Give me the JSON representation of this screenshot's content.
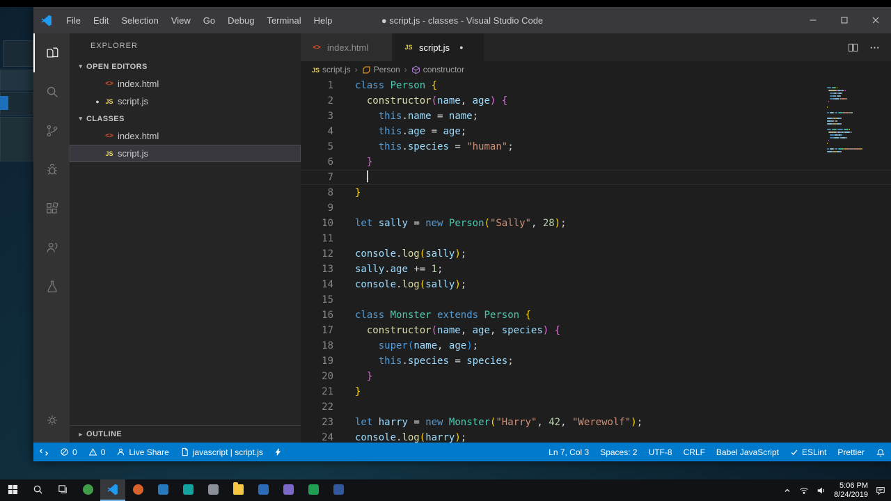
{
  "window": {
    "title": "● script.js - classes - Visual Studio Code",
    "menus": [
      "File",
      "Edit",
      "Selection",
      "View",
      "Go",
      "Debug",
      "Terminal",
      "Help"
    ]
  },
  "activity_bar": {
    "top": [
      {
        "name": "explorer",
        "icon": "explorer-icon",
        "active": true
      },
      {
        "name": "search",
        "icon": "search-icon"
      },
      {
        "name": "source-control",
        "icon": "source-control-icon"
      },
      {
        "name": "debug",
        "icon": "debug-icon"
      },
      {
        "name": "extensions",
        "icon": "extensions-icon"
      },
      {
        "name": "live-share",
        "icon": "live-share-icon"
      },
      {
        "name": "test",
        "icon": "test-icon"
      }
    ],
    "bottom": [
      {
        "name": "settings",
        "icon": "settings-icon"
      }
    ]
  },
  "explorer": {
    "title": "EXPLORER",
    "open_editors": {
      "label": "OPEN EDITORS",
      "items": [
        {
          "file": "index.html",
          "type": "html",
          "modified": false
        },
        {
          "file": "script.js",
          "type": "js",
          "modified": true
        }
      ]
    },
    "folder": {
      "label": "CLASSES",
      "items": [
        {
          "file": "index.html",
          "type": "html",
          "selected": false
        },
        {
          "file": "script.js",
          "type": "js",
          "selected": true
        }
      ]
    },
    "outline_label": "OUTLINE"
  },
  "tabs": [
    {
      "label": "index.html",
      "type": "html",
      "active": false,
      "modified": false
    },
    {
      "label": "script.js",
      "type": "js",
      "active": true,
      "modified": true
    }
  ],
  "breadcrumbs": [
    {
      "label": "script.js",
      "icon": "js-file-icon"
    },
    {
      "label": "Person",
      "icon": "symbol-class-icon"
    },
    {
      "label": "constructor",
      "icon": "symbol-method-icon"
    }
  ],
  "editor": {
    "cursor": {
      "line": 7,
      "col": 3
    },
    "lines": [
      [
        [
          "k",
          "class"
        ],
        [
          "p",
          " "
        ],
        [
          "c",
          "Person"
        ],
        [
          "p",
          " "
        ],
        [
          "1",
          "{"
        ]
      ],
      [
        [
          "p",
          "  "
        ],
        [
          "f",
          "constructor"
        ],
        [
          "2",
          "("
        ],
        [
          "v",
          "name"
        ],
        [
          "p",
          ", "
        ],
        [
          "v",
          "age"
        ],
        [
          "2",
          ")"
        ],
        [
          "p",
          " "
        ],
        [
          "2",
          "{"
        ]
      ],
      [
        [
          "p",
          "    "
        ],
        [
          "k",
          "this"
        ],
        [
          "p",
          "."
        ],
        [
          "v",
          "name"
        ],
        [
          "p",
          " = "
        ],
        [
          "v",
          "name"
        ],
        [
          "p",
          ";"
        ]
      ],
      [
        [
          "p",
          "    "
        ],
        [
          "k",
          "this"
        ],
        [
          "p",
          "."
        ],
        [
          "v",
          "age"
        ],
        [
          "p",
          " = "
        ],
        [
          "v",
          "age"
        ],
        [
          "p",
          ";"
        ]
      ],
      [
        [
          "p",
          "    "
        ],
        [
          "k",
          "this"
        ],
        [
          "p",
          "."
        ],
        [
          "v",
          "species"
        ],
        [
          "p",
          " = "
        ],
        [
          "s",
          "\"human\""
        ],
        [
          "p",
          ";"
        ]
      ],
      [
        [
          "p",
          "  "
        ],
        [
          "2",
          "}"
        ]
      ],
      [
        [
          "p",
          "  "
        ]
      ],
      [
        [
          "1",
          "}"
        ]
      ],
      [],
      [
        [
          "k",
          "let"
        ],
        [
          "p",
          " "
        ],
        [
          "v",
          "sally"
        ],
        [
          "p",
          " = "
        ],
        [
          "k",
          "new"
        ],
        [
          "p",
          " "
        ],
        [
          "c",
          "Person"
        ],
        [
          "1",
          "("
        ],
        [
          "s",
          "\"Sally\""
        ],
        [
          "p",
          ", "
        ],
        [
          "n",
          "28"
        ],
        [
          "1",
          ")"
        ],
        [
          "p",
          ";"
        ]
      ],
      [],
      [
        [
          "v",
          "console"
        ],
        [
          "p",
          "."
        ],
        [
          "f",
          "log"
        ],
        [
          "1",
          "("
        ],
        [
          "v",
          "sally"
        ],
        [
          "1",
          ")"
        ],
        [
          "p",
          ";"
        ]
      ],
      [
        [
          "v",
          "sally"
        ],
        [
          "p",
          "."
        ],
        [
          "v",
          "age"
        ],
        [
          "p",
          " += "
        ],
        [
          "n",
          "1"
        ],
        [
          "p",
          ";"
        ]
      ],
      [
        [
          "v",
          "console"
        ],
        [
          "p",
          "."
        ],
        [
          "f",
          "log"
        ],
        [
          "1",
          "("
        ],
        [
          "v",
          "sally"
        ],
        [
          "1",
          ")"
        ],
        [
          "p",
          ";"
        ]
      ],
      [],
      [
        [
          "k",
          "class"
        ],
        [
          "p",
          " "
        ],
        [
          "c",
          "Monster"
        ],
        [
          "p",
          " "
        ],
        [
          "k",
          "extends"
        ],
        [
          "p",
          " "
        ],
        [
          "c",
          "Person"
        ],
        [
          "p",
          " "
        ],
        [
          "1",
          "{"
        ]
      ],
      [
        [
          "p",
          "  "
        ],
        [
          "f",
          "constructor"
        ],
        [
          "2",
          "("
        ],
        [
          "v",
          "name"
        ],
        [
          "p",
          ", "
        ],
        [
          "v",
          "age"
        ],
        [
          "p",
          ", "
        ],
        [
          "v",
          "species"
        ],
        [
          "2",
          ")"
        ],
        [
          "p",
          " "
        ],
        [
          "2",
          "{"
        ]
      ],
      [
        [
          "p",
          "    "
        ],
        [
          "k",
          "super"
        ],
        [
          "3",
          "("
        ],
        [
          "v",
          "name"
        ],
        [
          "p",
          ", "
        ],
        [
          "v",
          "age"
        ],
        [
          "3",
          ")"
        ],
        [
          "p",
          ";"
        ]
      ],
      [
        [
          "p",
          "    "
        ],
        [
          "k",
          "this"
        ],
        [
          "p",
          "."
        ],
        [
          "v",
          "species"
        ],
        [
          "p",
          " = "
        ],
        [
          "v",
          "species"
        ],
        [
          "p",
          ";"
        ]
      ],
      [
        [
          "p",
          "  "
        ],
        [
          "2",
          "}"
        ]
      ],
      [
        [
          "1",
          "}"
        ]
      ],
      [],
      [
        [
          "k",
          "let"
        ],
        [
          "p",
          " "
        ],
        [
          "v",
          "harry"
        ],
        [
          "p",
          " = "
        ],
        [
          "k",
          "new"
        ],
        [
          "p",
          " "
        ],
        [
          "c",
          "Monster"
        ],
        [
          "1",
          "("
        ],
        [
          "s",
          "\"Harry\""
        ],
        [
          "p",
          ", "
        ],
        [
          "n",
          "42"
        ],
        [
          "p",
          ", "
        ],
        [
          "s",
          "\"Werewolf\""
        ],
        [
          "1",
          ")"
        ],
        [
          "p",
          ";"
        ]
      ],
      [
        [
          "v",
          "console"
        ],
        [
          "p",
          "."
        ],
        [
          "f",
          "log"
        ],
        [
          "1",
          "("
        ],
        [
          "v",
          "harry"
        ],
        [
          "1",
          ")"
        ],
        [
          "p",
          ";"
        ]
      ]
    ]
  },
  "status_bar": {
    "left": [
      {
        "name": "remote",
        "icon": "remote-icon",
        "label": ""
      },
      {
        "name": "errors",
        "icon": "error-icon",
        "label": "0"
      },
      {
        "name": "warnings",
        "icon": "warning-icon",
        "label": "0"
      },
      {
        "name": "live-share",
        "icon": "person-icon",
        "label": "Live Share"
      },
      {
        "name": "active-file",
        "icon": "codefile-icon",
        "label": "javascript | script.js"
      },
      {
        "name": "quick-action",
        "icon": "lightning-icon",
        "label": ""
      }
    ],
    "right": [
      {
        "name": "cursor-position",
        "label": "Ln 7, Col 3"
      },
      {
        "name": "indentation",
        "label": "Spaces: 2"
      },
      {
        "name": "encoding",
        "label": "UTF-8"
      },
      {
        "name": "eol",
        "label": "CRLF"
      },
      {
        "name": "language-mode",
        "label": "Babel JavaScript"
      },
      {
        "name": "eslint",
        "icon": "check-icon",
        "label": "ESLint"
      },
      {
        "name": "prettier",
        "label": "Prettier"
      },
      {
        "name": "notifications",
        "icon": "bell-icon",
        "label": ""
      }
    ]
  },
  "taskbar": {
    "apps": [
      {
        "name": "start",
        "icon": "windows-icon"
      },
      {
        "name": "search",
        "icon": "search-circle-icon"
      },
      {
        "name": "task-view",
        "icon": "task-view-icon"
      },
      {
        "name": "browser",
        "color": "#3f9d49",
        "shape": "circle"
      },
      {
        "name": "vscode",
        "icon": "vscode-logo",
        "active": true
      },
      {
        "name": "app-3",
        "color": "#d8622a",
        "shape": "circle"
      },
      {
        "name": "app-4",
        "color": "#2779bd",
        "shape": "square"
      },
      {
        "name": "app-5",
        "color": "#12a5a0",
        "shape": "square"
      },
      {
        "name": "app-6",
        "color": "#8a8f98",
        "shape": "square"
      },
      {
        "name": "file-explorer",
        "color": "#f7c744",
        "shape": "folder"
      },
      {
        "name": "app-8",
        "color": "#2b6cb8",
        "shape": "square"
      },
      {
        "name": "app-9",
        "color": "#7b68c8",
        "shape": "square"
      },
      {
        "name": "app-10",
        "color": "#1e9e50",
        "shape": "square"
      },
      {
        "name": "app-11",
        "color": "#31589c",
        "shape": "square"
      }
    ],
    "tray": {
      "time": "5:06 PM",
      "date": "8/24/2019"
    }
  },
  "colors": {
    "accent": "#007acc",
    "editor_background": "#1e1e1e",
    "taskbar_active_underline": "#75b6e7"
  }
}
